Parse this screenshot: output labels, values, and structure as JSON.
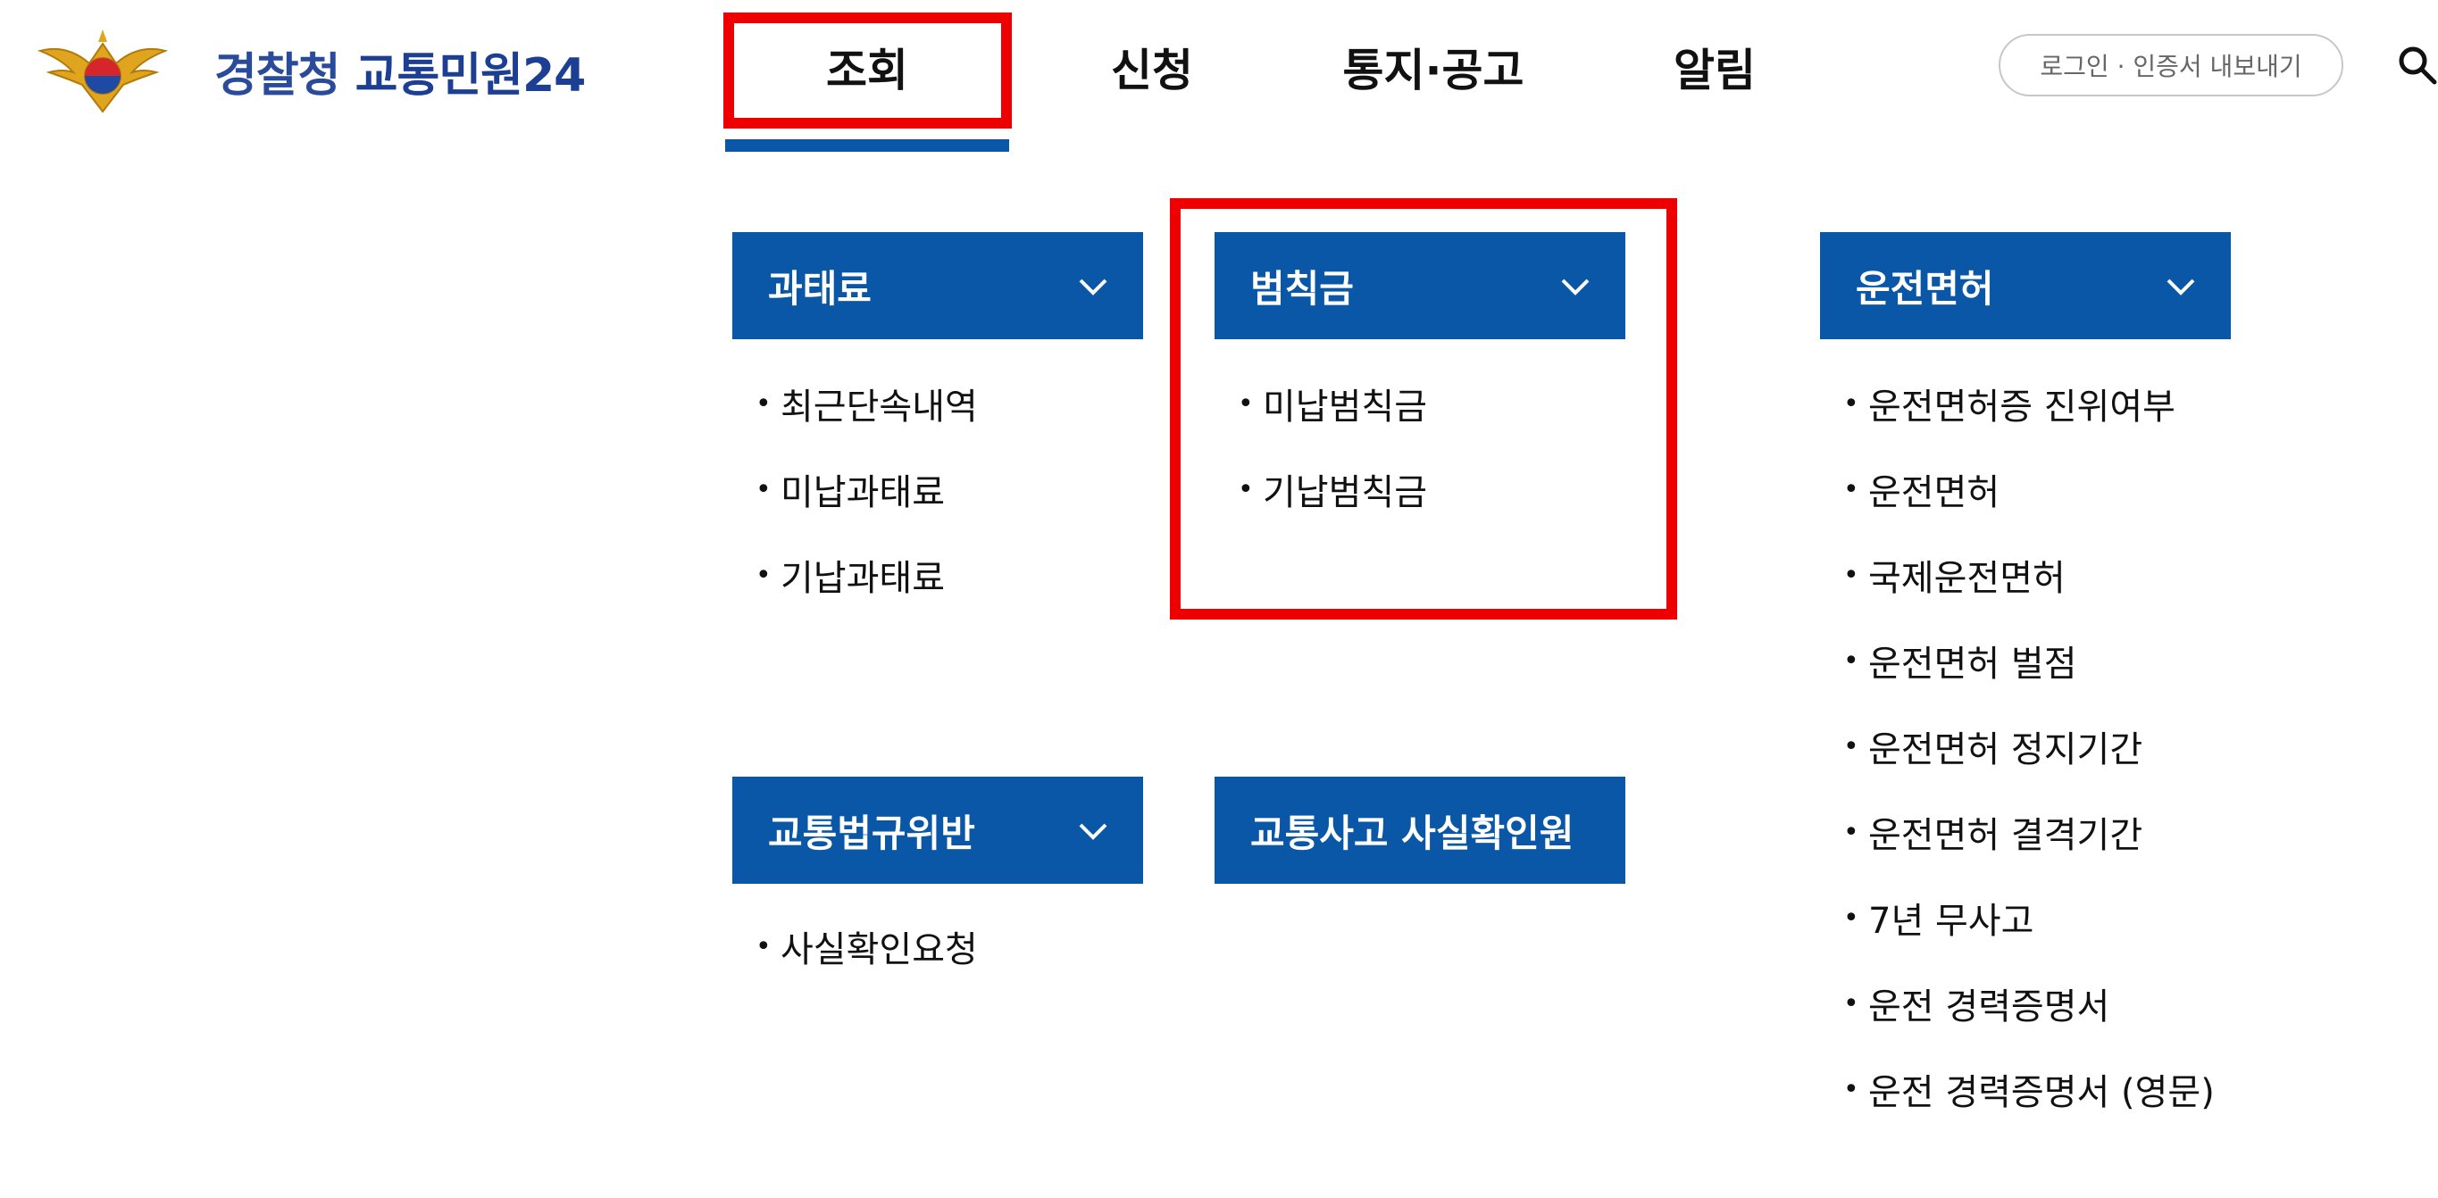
{
  "header": {
    "logo_prefix": "경찰청",
    "logo_title": "교통민원24",
    "nav": [
      "조회",
      "신청",
      "통지·공고",
      "알림"
    ],
    "login_label": "로그인 · 인증서 내보내기"
  },
  "menu": {
    "fine": {
      "title": "과태료",
      "items": [
        "최근단속내역",
        "미납과태료",
        "기납과태료"
      ]
    },
    "penalty": {
      "title": "범칙금",
      "items": [
        "미납범칙금",
        "기납범칙금"
      ]
    },
    "license": {
      "title": "운전면허",
      "items": [
        "운전면허증 진위여부",
        "운전면허",
        "국제운전면허",
        "운전면허 벌점",
        "운전면허 정지기간",
        "운전면허 결격기간",
        "7년 무사고",
        "운전 경력증명서",
        "운전 경력증명서 (영문)"
      ]
    },
    "violation": {
      "title": "교통법규위반",
      "items": [
        "사실확인요청"
      ]
    },
    "accident": {
      "title": "교통사고 사실확인원"
    }
  },
  "colors": {
    "primary": "#0a57a8",
    "highlight": "#ee0000",
    "logo": "#2a4b9b"
  },
  "icons": {
    "search": "search-icon",
    "chevron": "chevron-down-icon",
    "emblem": "police-emblem-icon"
  }
}
